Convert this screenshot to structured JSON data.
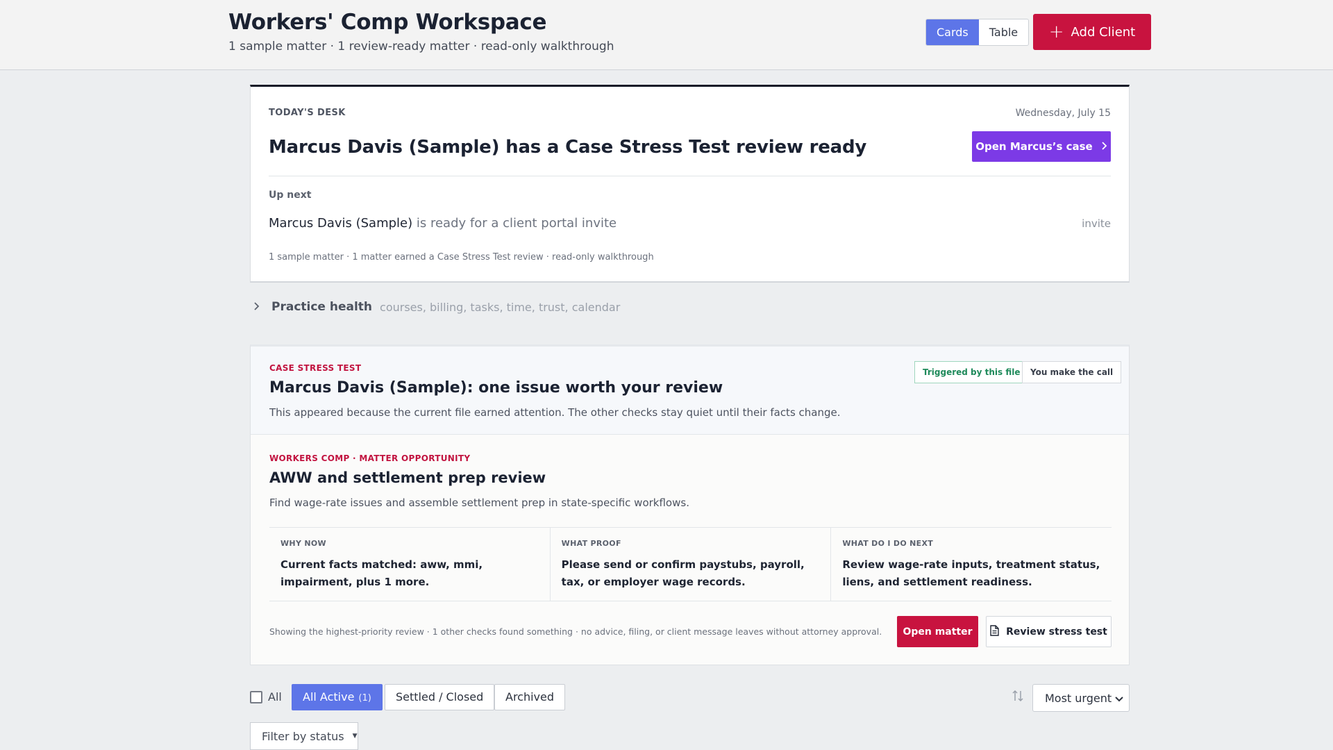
{
  "header": {
    "title": "Workers' Comp Workspace",
    "subtitle": "1 sample matter · 1 review-ready matter · read-only walkthrough",
    "view_cards": "Cards",
    "view_table": "Table",
    "add_client": "Add Client"
  },
  "desk": {
    "eyebrow": "TODAY'S DESK",
    "date": "Wednesday, July 15",
    "headline": "Marcus Davis (Sample) has a Case Stress Test review ready",
    "open_case": "Open Marcus’s case",
    "up_next_label": "Up next",
    "up_next_name": "Marcus Davis (Sample)",
    "up_next_text": " is ready for a client portal invite",
    "invite": "invite",
    "summary": "1 sample matter · 1 matter earned a Case Stress Test review · read-only walkthrough"
  },
  "practice_health": {
    "label": "Practice health",
    "meta": "courses, billing, tasks, time, trust, calendar"
  },
  "stress_test": {
    "eyebrow": "CASE STRESS TEST",
    "title": "Marcus Davis (Sample): one issue worth your review",
    "lead": "This appeared because the current file earned attention. The other checks stay quiet until their facts change.",
    "badge_triggered": "Triggered by this file",
    "badge_call": "You make the call",
    "opp_eyebrow": "WORKERS COMP · MATTER OPPORTUNITY",
    "opp_title": "AWW and settlement prep review",
    "opp_desc": "Find wage-rate issues and assemble settlement prep in state-specific workflows.",
    "columns": [
      {
        "key": "WHY NOW",
        "value": "Current facts matched: aww, mmi, impairment, plus 1 more."
      },
      {
        "key": "WHAT PROOF",
        "value": "Please send or confirm paystubs, payroll, tax, or employer wage records."
      },
      {
        "key": "WHAT DO I DO NEXT",
        "value": "Review wage-rate inputs, treatment status, liens, and settlement readiness."
      }
    ],
    "footer": "Showing the highest-priority review · 1 other checks found something · no advice, filing, or client message leaves without attorney approval.",
    "open_matter": "Open matter",
    "review_stress": "Review stress test"
  },
  "filters": {
    "all_label": "All",
    "all_active": "All Active",
    "all_active_count": "(1)",
    "settled": "Settled / Closed",
    "archived": "Archived",
    "sort_selected": "Most urgent",
    "status_filter": "Filter by status"
  },
  "colors": {
    "accent_blue": "#5d75e8",
    "brand_red": "#c8133f",
    "purple": "#7c3ae6",
    "success_green": "#1f8a5b"
  }
}
